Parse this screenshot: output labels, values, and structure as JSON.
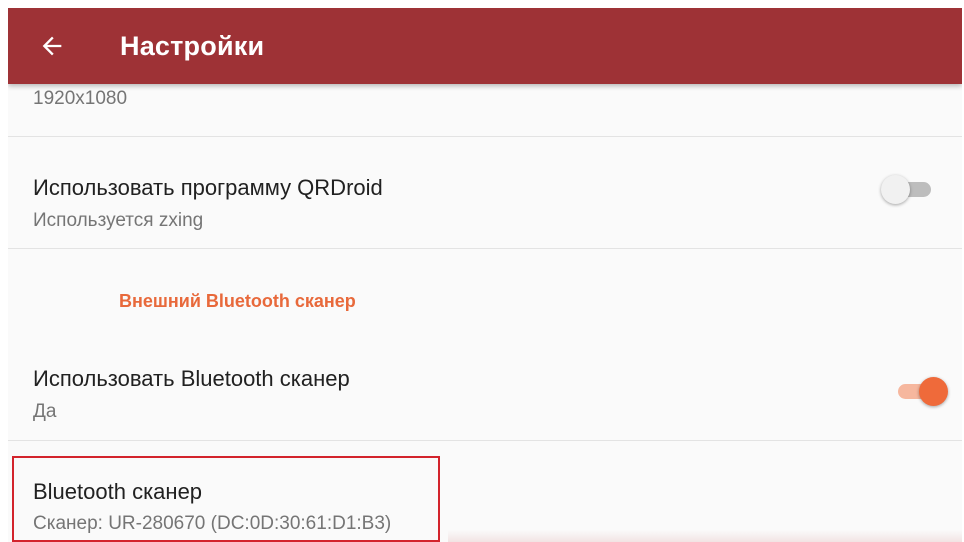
{
  "appbar": {
    "title": "Настройки",
    "back_icon": "arrow-left-icon",
    "color": "#9e3236"
  },
  "preferences": {
    "resolution_summary": "1920x1080",
    "qrdroid": {
      "title": "Использовать программу QRDroid",
      "summary": "Используется zxing",
      "enabled": false
    },
    "category_bluetooth": "Внешний Bluetooth сканер",
    "use_bluetooth": {
      "title": "Использовать Bluetooth сканер",
      "summary": "Да",
      "enabled": true
    },
    "bluetooth_scanner": {
      "title": "Bluetooth сканер",
      "summary": "Сканер: UR-280670 (DC:0D:30:61:D1:B3)"
    }
  },
  "colors": {
    "accent": "#ef6a3a",
    "category_text": "#e8693b",
    "highlight_border": "#d3232c"
  }
}
